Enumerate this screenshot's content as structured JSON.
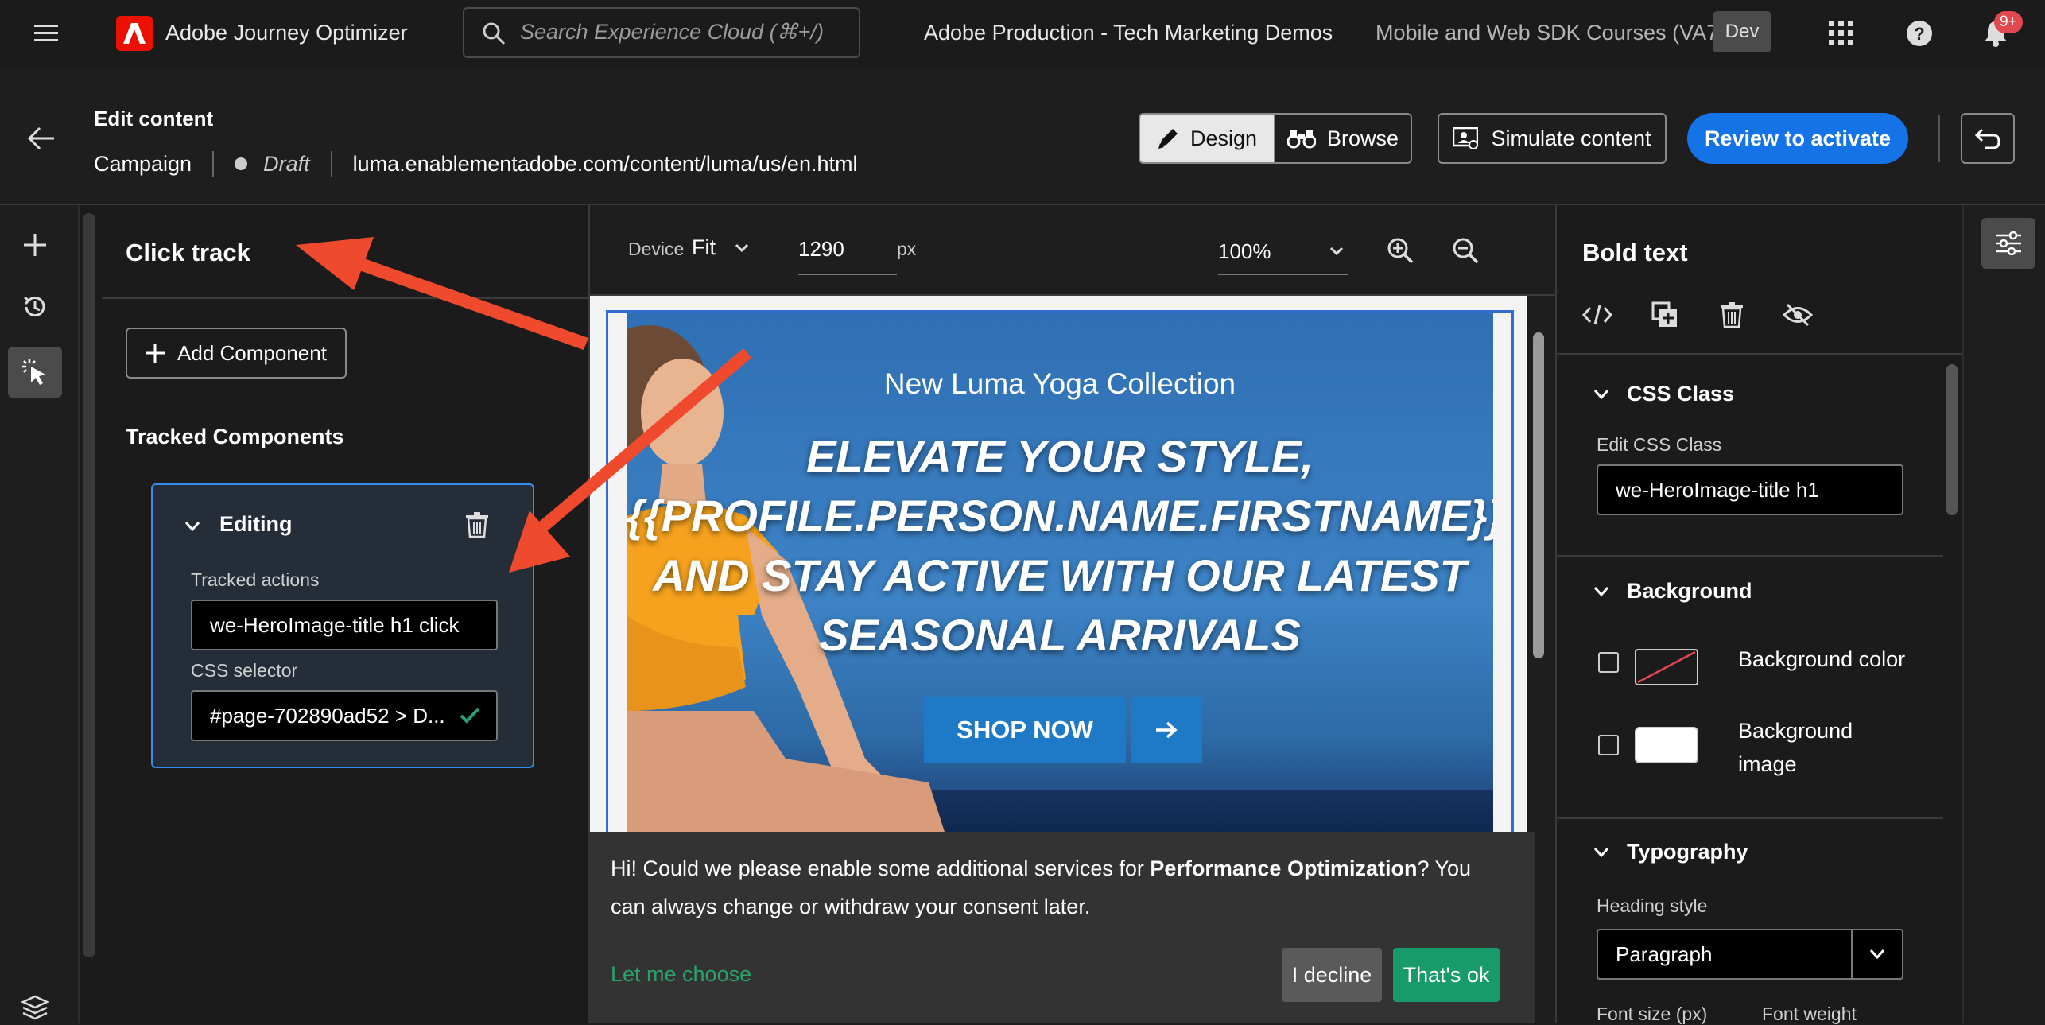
{
  "topbar": {
    "app_name": "Adobe Journey Optimizer",
    "search_placeholder": "Search Experience Cloud (⌘+/)",
    "org": "Adobe Production - Tech Marketing Demos",
    "sandbox": "Mobile and Web SDK Courses (VA7)",
    "env_badge": "Dev",
    "notif_count": "9+"
  },
  "header": {
    "title": "Edit content",
    "type": "Campaign",
    "status": "Draft",
    "url": "luma.enablementadobe.com/content/luma/us/en.html",
    "design_label": "Design",
    "browse_label": "Browse",
    "simulate_label": "Simulate content",
    "review_label": "Review to activate"
  },
  "left_panel": {
    "title": "Click track",
    "add_component": "Add Component",
    "tracked_heading": "Tracked Components",
    "component": {
      "name": "Editing",
      "tracked_actions_label": "Tracked actions",
      "tracked_actions_value": "we-HeroImage-title h1 click",
      "css_selector_label": "CSS selector",
      "css_selector_value": "#page-702890ad52 > D..."
    }
  },
  "canvas_toolbar": {
    "device_label": "Device",
    "device_value": "Fit",
    "width_value": "1290",
    "width_unit": "px",
    "zoom_value": "100%"
  },
  "hero": {
    "subtitle": "New Luma Yoga Collection",
    "title_lines": [
      "ELEVATE YOUR STYLE,",
      "{{PROFILE.PERSON.NAME.FIRSTNAME}}",
      "AND STAY ACTIVE WITH OUR LATEST",
      "SEASONAL ARRIVALS"
    ],
    "cta": "SHOP NOW"
  },
  "consent": {
    "text_before": "Hi! Could we please enable some additional services for ",
    "text_bold": "Performance Optimization",
    "text_after": "? You can always change or withdraw your consent later.",
    "choose_link": "Let me choose",
    "decline": "I decline",
    "accept": "That's ok"
  },
  "right_panel": {
    "title": "Bold text",
    "css_class_section": "CSS Class",
    "edit_css_label": "Edit CSS Class",
    "edit_css_value": "we-HeroImage-title h1",
    "background_section": "Background",
    "bg_color_label": "Background color",
    "bg_image_label_1": "Background",
    "bg_image_label_2": "image",
    "typography_section": "Typography",
    "heading_style_label": "Heading style",
    "heading_style_value": "Paragraph",
    "font_size_label": "Font size (px)",
    "font_weight_label": "Font weight"
  },
  "colors": {
    "accent": "#1473e6",
    "annotation_arrow": "#f04a2e",
    "accept_green": "#179b6a",
    "link_green": "#2aa36b",
    "check_green": "#2d9d78"
  }
}
